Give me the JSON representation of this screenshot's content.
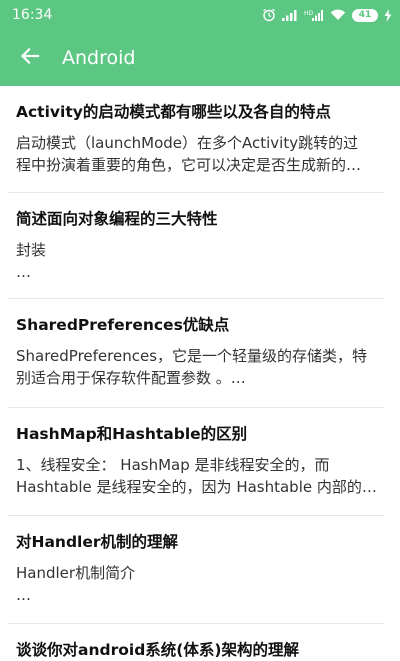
{
  "status_bar": {
    "time": "16:34",
    "battery_level": "41",
    "icons": [
      "alarm-icon",
      "signal-icon",
      "signal-hd-icon",
      "wifi-icon",
      "battery-icon",
      "charging-icon"
    ]
  },
  "app_bar": {
    "title": "Android",
    "back_icon": "arrow-back-icon"
  },
  "colors": {
    "accent": "#5cc683",
    "title_text": "#111111",
    "body_text": "#333333"
  },
  "items": [
    {
      "title": "Activity的启动模式都有哪些以及各自的特点",
      "lines": [
        "启动模式（launchMode）在多个Activity跳转的过",
        "程中扮演着重要的角色，它可以决定是否生成新的…"
      ]
    },
    {
      "title": "简述面向对象编程的三大特性",
      "lines": [
        "封装",
        "…"
      ]
    },
    {
      "title": "SharedPreferences优缺点",
      "lines": [
        "SharedPreferences，它是一个轻量级的存储类，特",
        "别适合用于保存软件配置参数 。…"
      ]
    },
    {
      "title": "HashMap和Hashtable的区别",
      "lines": [
        "1、线程安全： HashMap 是非线程安全的，而",
        "Hashtable 是线程安全的，因为 Hashtable 内部的…"
      ]
    },
    {
      "title": "对Handler机制的理解",
      "lines": [
        "Handler机制简介",
        "…"
      ]
    },
    {
      "title": "谈谈你对android系统(体系)架构的理解",
      "lines": [
        "",
        ""
      ]
    }
  ]
}
